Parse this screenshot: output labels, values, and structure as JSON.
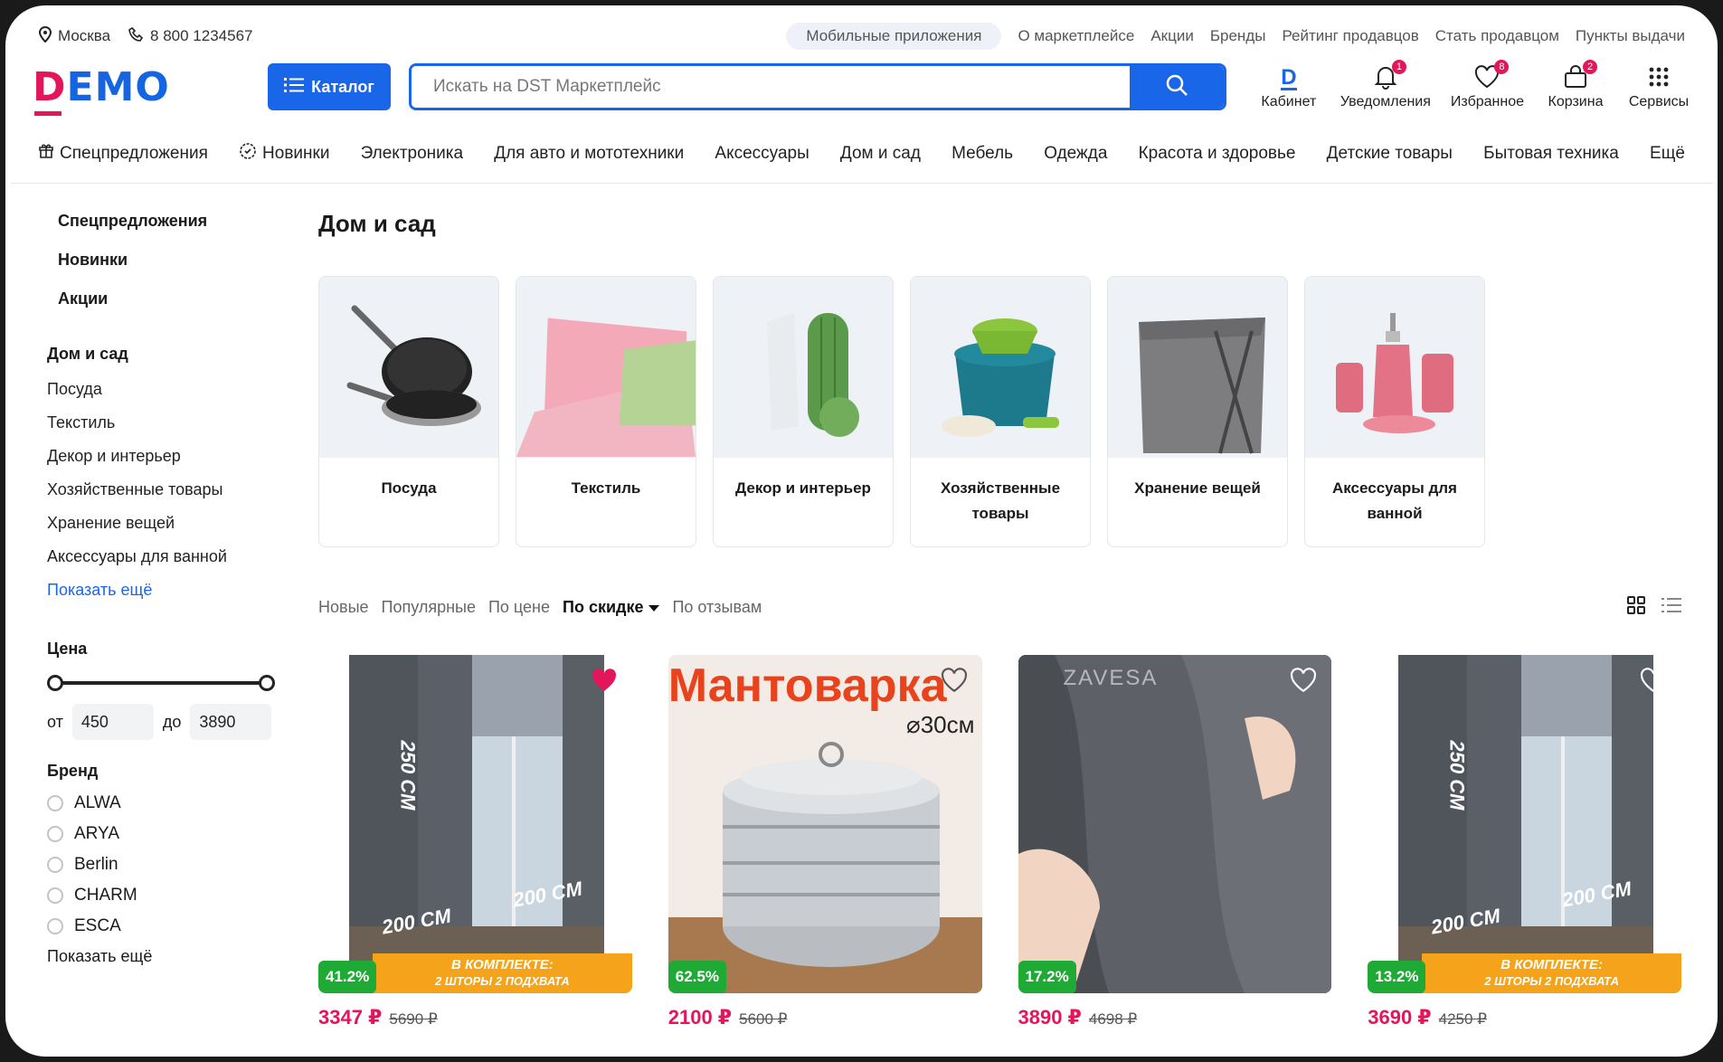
{
  "topbar": {
    "city": "Москва",
    "phone": "8 800 1234567",
    "links": [
      "Мобильные приложения",
      "О маркетплейсе",
      "Акции",
      "Бренды",
      "Рейтинг продавцов",
      "Стать продавцом",
      "Пункты выдачи"
    ]
  },
  "header": {
    "logo": "DEMO",
    "catalog_label": "Каталог",
    "search_placeholder": "Искать на DST Маркетплейс",
    "icons": [
      {
        "label": "Кабинет",
        "badge": ""
      },
      {
        "label": "Уведомления",
        "badge": "1"
      },
      {
        "label": "Избранное",
        "badge": "8"
      },
      {
        "label": "Корзина",
        "badge": "2"
      },
      {
        "label": "Сервисы",
        "badge": ""
      }
    ]
  },
  "nav": [
    "Спецпредложения",
    "Новинки",
    "Электроника",
    "Для авто и мототехники",
    "Аксессуары",
    "Дом и сад",
    "Мебель",
    "Одежда",
    "Красота и здоровье",
    "Детские товары",
    "Бытовая техника",
    "Ещё"
  ],
  "sidebar": {
    "top": [
      "Спецпредложения",
      "Новинки",
      "Акции"
    ],
    "section_title": "Дом и сад",
    "links": [
      "Посуда",
      "Текстиль",
      "Декор и интерьер",
      "Хозяйственные товары",
      "Хранение вещей",
      "Аксессуары для ванной"
    ],
    "show_more": "Показать ещё",
    "price_title": "Цена",
    "from_label": "от",
    "to_label": "до",
    "price_from": "450",
    "price_to": "3890",
    "brand_title": "Бренд",
    "brands": [
      "ALWA",
      "ARYA",
      "Berlin",
      "CHARM",
      "ESCA"
    ],
    "brand_more": "Показать ещё"
  },
  "main": {
    "title": "Дом и сад",
    "categories": [
      "Посуда",
      "Текстиль",
      "Декор и интерьер",
      "Хозяйственные товары",
      "Хранение вещей",
      "Аксессуары для ванной"
    ],
    "sort": [
      "Новые",
      "Популярные",
      "По цене",
      "По скидке",
      "По отзывам"
    ],
    "sort_active": "По скидке"
  },
  "products": [
    {
      "discount": "41.2%",
      "price": "3347 ₽",
      "old_price": "5690 ₽",
      "favorite": true,
      "promo_line1": "В КОМПЛЕКТЕ:",
      "promo_line2": "2 ШТОРЫ   2 ПОДХВАТА",
      "dim_v": "250 СМ",
      "dim_h1": "200 СМ",
      "dim_h2": "200 СМ"
    },
    {
      "discount": "62.5%",
      "price": "2100 ₽",
      "old_price": "5600 ₽",
      "favorite": false,
      "title": "Мантоварка",
      "size": "⌀30см"
    },
    {
      "discount": "17.2%",
      "price": "3890 ₽",
      "old_price": "4698 ₽",
      "favorite": false,
      "watermark": "ZAVESA"
    },
    {
      "discount": "13.2%",
      "price": "3690 ₽",
      "old_price": "4250 ₽",
      "favorite": false,
      "promo_line1": "В КОМПЛЕКТЕ:",
      "promo_line2": "2 ШТОРЫ   2 ПОДХВАТА",
      "dim_v": "250 СМ",
      "dim_h1": "200 СМ",
      "dim_h2": "200 СМ"
    }
  ],
  "colors": {
    "accent": "#1a66e8",
    "brand_pink": "#e3165b",
    "discount_green": "#1faa36",
    "promo_orange": "#f5a31a"
  }
}
